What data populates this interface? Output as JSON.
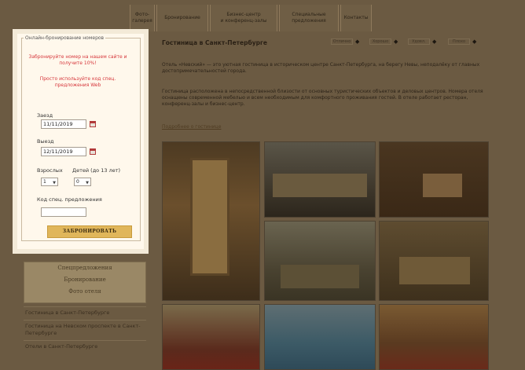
{
  "nav": {
    "items": [
      {
        "label": "Фото-\nгалерея"
      },
      {
        "label": "Бронирование"
      },
      {
        "label": "Бизнес-центр\nи конференц-залы"
      },
      {
        "label": "Специальные\nпредложения"
      },
      {
        "label": "Контакты"
      }
    ]
  },
  "booking": {
    "legend": "Онлайн-бронирование номеров",
    "promo_1": "Забронируйте номер на нашем сайте и получите 10%!",
    "promo_2": "Просто используйте код спец. предложения Web",
    "checkin_label": "Заезд",
    "checkin_value": "11/11/2019",
    "checkout_label": "Выезд",
    "checkout_value": "12/11/2019",
    "adults_label": "Взрослых",
    "children_label": "Детей (до 13 лет)",
    "adults_value": "1",
    "children_value": "0",
    "code_label": "Код спец. предложения",
    "code_value": "",
    "submit_label": "ЗАБРОНИРОВАТЬ"
  },
  "side": {
    "promo_lines": [
      "Спецпредложения",
      "Бронирование",
      "Фото отеля"
    ],
    "links": [
      "Гостиница в Санкт-Петербурге",
      "Гостиница на Невском проспекте в Санкт-Петербурге",
      "Отели в Санкт-Петербурге"
    ]
  },
  "main": {
    "title": "Гостиница в Санкт-Петербурге",
    "rating_labels": [
      "Отлично",
      "Хорошо",
      "Удовл.",
      "Плохо"
    ],
    "para_1": "Отель «Невский» — это уютная гостиница в историческом центре Санкт-Петербурга, на берегу Невы, неподалёку от главных достопримечательностей города.",
    "para_2": "Гостиница расположена в непосредственной близости от основных туристических объектов и деловых центров. Номера отеля оснащены современной мебелью и всем необходимым для комфортного проживания гостей. В отеле работает ресторан, конференц-залы и бизнес-центр.",
    "more_link": "Подробнее о гостинице"
  },
  "colors": {
    "overlay": "#5a4a36",
    "panel": "#fff8ec",
    "promo_red": "#d6363b",
    "button": "#e0b65a"
  }
}
